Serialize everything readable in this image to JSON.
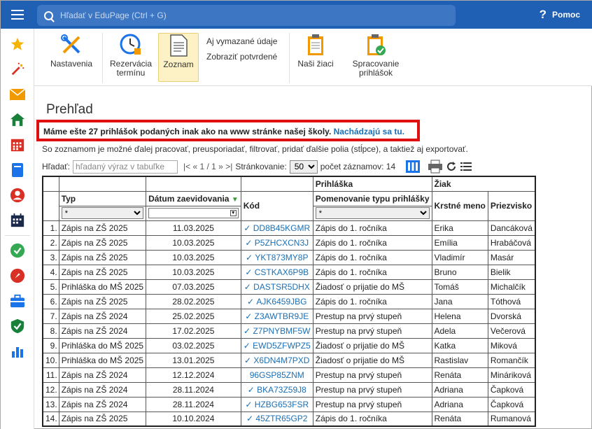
{
  "search": {
    "placeholder": "Hľadať v EduPage (Ctrl + G)"
  },
  "help": {
    "label": "Pomoc"
  },
  "ribbon": {
    "settings": "Nastavenia",
    "reservation_1": "Rezervácia",
    "reservation_2": "termínu",
    "list": "Zoznam",
    "deleted": "Aj vymazané údaje",
    "confirmations": "Zobraziť potvrdené",
    "students": "Naši žiaci",
    "processing_1": "Spracovanie",
    "processing_2": "prihlášok"
  },
  "page": {
    "title": "Prehľad",
    "notice_text": "Máme ešte 27 prihlášok podaných inak ako na www stránke našej školy.",
    "notice_link": "Nachádzajú sa tu.",
    "info": "So zoznamom je možné ďalej pracovať, preusporiadať, filtrovať, pridať ďalšie polia (stĺpce), a taktiež aj exportovať."
  },
  "filter": {
    "label": "Hľadať:",
    "placeholder": "hľadaný výraz v tabuľke",
    "pager": "|< « 1 / 1 » >|",
    "paging_label": "Stránkovanie:",
    "paging_value": "50",
    "count_label": "počet záznamov: 14"
  },
  "table": {
    "group_application": "Prihláška",
    "group_student": "Žiak",
    "col_type": "Typ",
    "col_date": "Dátum zaevidovania",
    "col_code": "Kód",
    "col_app_name": "Pomenovanie typu prihlášky",
    "col_first": "Krstné meno",
    "col_last": "Priezvisko",
    "filter_all": "*",
    "rows": [
      {
        "n": "1.",
        "type": "Zápis na ZŠ 2025",
        "date": "11.03.2025",
        "check": true,
        "code": "DD8B45KGMR",
        "app": "Zápis do 1. ročníka",
        "first": "Erika",
        "last": "Dancáková"
      },
      {
        "n": "2.",
        "type": "Zápis na ZŠ 2025",
        "date": "10.03.2025",
        "check": true,
        "code": "P5ZHCXCN3J",
        "app": "Zápis do 1. ročníka",
        "first": "Emília",
        "last": "Hrabáčová"
      },
      {
        "n": "3.",
        "type": "Zápis na ZŠ 2025",
        "date": "10.03.2025",
        "check": true,
        "code": "YKT873MY8P",
        "app": "Zápis do 1. ročníka",
        "first": "Vladimír",
        "last": "Masár"
      },
      {
        "n": "4.",
        "type": "Zápis na ZŠ 2025",
        "date": "10.03.2025",
        "check": true,
        "code": "CSTKAX6P9B",
        "app": "Zápis do 1. ročníka",
        "first": "Bruno",
        "last": "Bielik"
      },
      {
        "n": "5.",
        "type": "Prihláška do MŠ 2025",
        "date": "07.03.2025",
        "check": true,
        "code": "DASTSR5DHX",
        "app": "Žiadosť o prijatie do MŠ",
        "first": "Tomáš",
        "last": "Michalčík"
      },
      {
        "n": "6.",
        "type": "Zápis na ZŠ 2025",
        "date": "28.02.2025",
        "check": true,
        "code": "AJK6459JBG",
        "app": "Zápis do 1. ročníka",
        "first": "Jana",
        "last": "Tóthová"
      },
      {
        "n": "7.",
        "type": "Zápis na ZŠ 2024",
        "date": "25.02.2025",
        "check": true,
        "code": "Z3AWTBR9JE",
        "app": "Prestup na prvý stupeň",
        "first": "Helena",
        "last": "Dvorská"
      },
      {
        "n": "8.",
        "type": "Zápis na ZŠ 2024",
        "date": "17.02.2025",
        "check": true,
        "code": "Z7PNYBMF5W",
        "app": "Prestup na prvý stupeň",
        "first": "Adela",
        "last": "Večerová"
      },
      {
        "n": "9.",
        "type": "Prihláška do MŠ 2025",
        "date": "03.02.2025",
        "check": true,
        "code": "EWD5ZFWPZ5",
        "app": "Žiadosť o prijatie do MŠ",
        "first": "Katka",
        "last": "Miková"
      },
      {
        "n": "10.",
        "type": "Prihláška do MŠ 2025",
        "date": "13.01.2025",
        "check": true,
        "code": "X6DN4M7PXD",
        "app": "Žiadosť o prijatie do MŠ",
        "first": "Rastislav",
        "last": "Romančík"
      },
      {
        "n": "11.",
        "type": "Zápis na ZŠ 2024",
        "date": "12.12.2024",
        "check": false,
        "code": "96GSP85ZNM",
        "app": "Prestup na prvý stupeň",
        "first": "Renáta",
        "last": "Mináriková"
      },
      {
        "n": "12.",
        "type": "Zápis na ZŠ 2024",
        "date": "28.11.2024",
        "check": true,
        "code": "BKA73Z59J8",
        "app": "Prestup na prvý stupeň",
        "first": "Adriana",
        "last": "Čapková"
      },
      {
        "n": "13.",
        "type": "Zápis na ZŠ 2024",
        "date": "28.11.2024",
        "check": true,
        "code": "HZBG653FSR",
        "app": "Prestup na prvý stupeň",
        "first": "Adriana",
        "last": "Čapková"
      },
      {
        "n": "14.",
        "type": "Zápis na ZŠ 2025",
        "date": "10.10.2024",
        "check": true,
        "code": "45ZTR65GP2",
        "app": "Zápis do 1. ročníka",
        "first": "Renáta",
        "last": "Rumanová"
      }
    ]
  },
  "icons": {
    "sidebar": [
      "star-icon",
      "magic-wand-icon",
      "mail-icon",
      "home-icon",
      "calendar-icon",
      "book-icon",
      "user-icon",
      "timetable-icon",
      "check-badge-icon",
      "rocket-badge-icon",
      "briefcase-icon",
      "shield-check-icon",
      "bar-chart-icon"
    ],
    "colors": {
      "topbar": "#1f5fb4",
      "link": "#1a6fb5",
      "notice_border": "#e01010",
      "active_bg": "#fdf2c5"
    }
  }
}
